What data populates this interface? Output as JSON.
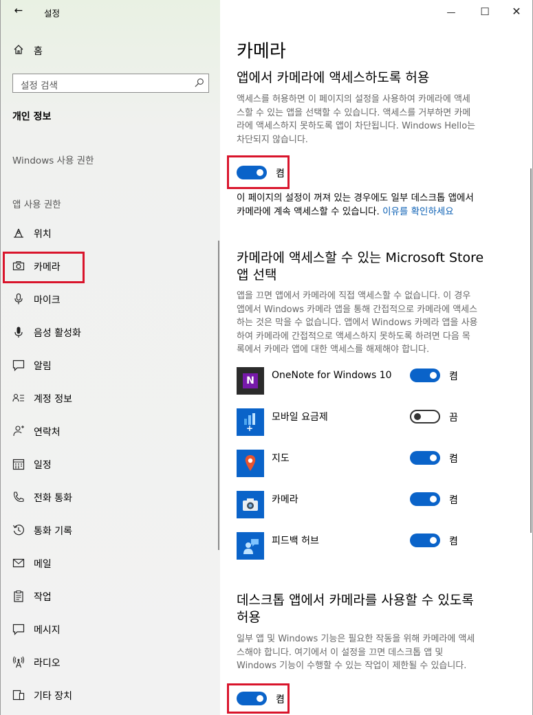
{
  "window": {
    "title": "설정",
    "back_icon": "←",
    "minimize_icon": "—",
    "maximize_icon": "☐",
    "close_icon": "✕"
  },
  "sidebar": {
    "home_label": "홈",
    "search_placeholder": "설정 검색",
    "section_title": "개인 정보",
    "group_windows": "Windows 사용 권한",
    "group_apps": "앱 사용 권한",
    "items": [
      {
        "label": "위치",
        "icon": "location-icon"
      },
      {
        "label": "카메라",
        "icon": "camera-icon",
        "selected": true
      },
      {
        "label": "마이크",
        "icon": "microphone-icon"
      },
      {
        "label": "음성 활성화",
        "icon": "voice-icon"
      },
      {
        "label": "알림",
        "icon": "notification-icon"
      },
      {
        "label": "계정 정보",
        "icon": "account-info-icon"
      },
      {
        "label": "연락처",
        "icon": "contacts-icon"
      },
      {
        "label": "일정",
        "icon": "calendar-icon"
      },
      {
        "label": "전화 통화",
        "icon": "phone-icon"
      },
      {
        "label": "통화 기록",
        "icon": "call-history-icon"
      },
      {
        "label": "메일",
        "icon": "mail-icon"
      },
      {
        "label": "작업",
        "icon": "tasks-icon"
      },
      {
        "label": "메시지",
        "icon": "message-icon"
      },
      {
        "label": "라디오",
        "icon": "radio-icon"
      },
      {
        "label": "기타 장치",
        "icon": "other-devices-icon"
      }
    ]
  },
  "main": {
    "page_title": "카메라",
    "section1": {
      "heading": "앱에서 카메라에 액세스하도록 허용",
      "desc_lines": [
        "액세스를 허용하면 이 페이지의 설정을 사용하여 카메라에 액세",
        "스할 수 있는 앱을 선택할 수 있습니다. 액세스를 거부하면 카메",
        "라에 액세스하지 못하도록 앱이 차단됩니다. Windows Hello는",
        "차단되지 않습니다."
      ],
      "toggle_state": "켬",
      "toggle_on": true,
      "note_line1": "이 페이지의 설정이 꺼져 있는 경우에도 일부 데스크톱 앱에서",
      "note_line2": "카메라에 계속 액세스할 수 있습니다.",
      "note_link": "이유를 확인하세요"
    },
    "section2": {
      "heading_line1": "카메라에 액세스할 수 있는 Microsoft Store",
      "heading_line2": "앱 선택",
      "desc_lines": [
        "앱을 끄면 앱에서 카메라에 직접 액세스할 수 없습니다. 이 경우",
        "앱에서 Windows 카메라 앱을 통해 간접적으로 카메라에 액세스",
        "하는 것은 막을 수 없습니다. 앱에서 Windows 카메라 앱을 사용",
        "하여 카메라에 간접적으로 액세스하지 못하도록 하려면 다음 목",
        "록에서 카메라 앱에 대한 액세스를 해제해야 합니다."
      ],
      "apps": [
        {
          "name": "OneNote for Windows 10",
          "state": "켬",
          "on": true,
          "icon": "onenote-icon",
          "color": "#2b2b2b"
        },
        {
          "name": "모바일 요금제",
          "state": "끔",
          "on": false,
          "icon": "mobile-plans-icon",
          "color": "#0a63c9"
        },
        {
          "name": "지도",
          "state": "켬",
          "on": true,
          "icon": "maps-icon",
          "color": "#0a63c9"
        },
        {
          "name": "카메라",
          "state": "켬",
          "on": true,
          "icon": "camera-app-icon",
          "color": "#0a63c9"
        },
        {
          "name": "피드백 허브",
          "state": "켬",
          "on": true,
          "icon": "feedback-hub-icon",
          "color": "#0a63c9"
        }
      ]
    },
    "section3": {
      "heading_line1": "데스크톱 앱에서 카메라를 사용할 수 있도록",
      "heading_line2": "허용",
      "desc_lines": [
        "일부 앱 및 Windows 기능은 필요한 작동을 위해 카메라에 액세",
        "스해야 합니다. 여기에서 이 설정을 끄면 데스크톱 앱 및",
        "Windows 기능이 수행할 수 있는 작업이 제한될 수 있습니다."
      ],
      "toggle_state": "켬",
      "toggle_on": true
    }
  },
  "colors": {
    "accent": "#0a63c9",
    "highlight": "#d9142b",
    "link": "#0a5fb4"
  }
}
